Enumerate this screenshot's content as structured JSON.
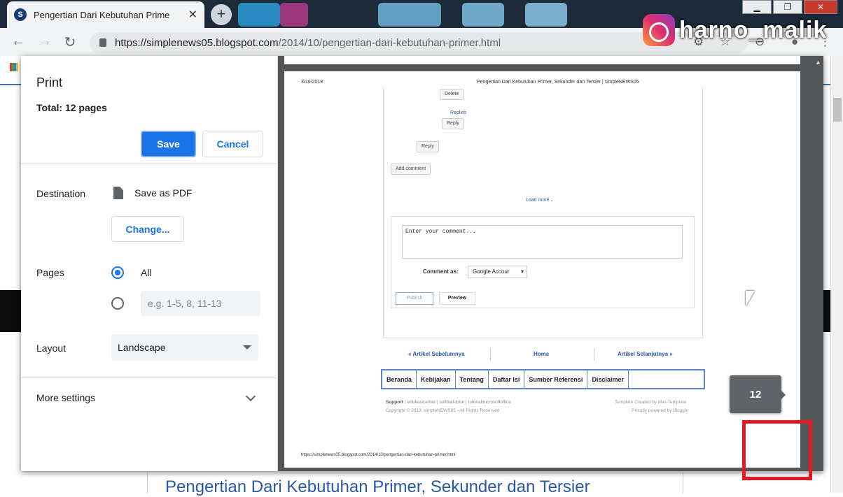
{
  "browser": {
    "tab_title": "Pengertian Dari Kebutuhan Prime",
    "tab_close": "✕",
    "new_tab": "+",
    "url_host": "https://simplenews05.blogspot.com",
    "url_path": "/2014/10/pengertian-dari-kebutuhan-primer.html",
    "window_controls": [
      "▁",
      "❐",
      "✕"
    ]
  },
  "watermark": {
    "text": "harno_malik"
  },
  "page_behind": {
    "heading": "Pengertian Dari Kebutuhan Primer, Sekunder dan Tersier"
  },
  "print": {
    "title": "Print",
    "total": "Total: 12 pages",
    "save_label": "Save",
    "cancel_label": "Cancel",
    "destination_label": "Destination",
    "destination_value": "Save as PDF",
    "change_label": "Change...",
    "pages_label": "Pages",
    "pages_all": "All",
    "pages_placeholder": "e.g. 1-5, 8, 11-13",
    "layout_label": "Layout",
    "layout_value": "Landscape",
    "more_settings": "More settings"
  },
  "preview": {
    "header_date": "3/16/2019",
    "header_title": "Pengertian Dari Kebutuhan Primer, Sekunder dan Tersier | simpleNEWS05",
    "delete": "Delete",
    "replies": "Replies",
    "reply": "Reply",
    "add_comment": "Add comment",
    "load_more": "Load more...",
    "comment_placeholder": "Enter your comment...",
    "comment_as": "Comment as:",
    "comment_as_value": "Google Accour",
    "publish": "Publish",
    "preview": "Preview",
    "prev_article": "« Artikel Sebelumnya",
    "home": "Home",
    "next_article": "Artikel Selanjutnya »",
    "menu": [
      "Beranda",
      "Kebijakan",
      "Tentang",
      "Daftar Isi",
      "Sumber Referensi",
      "Disclaimer"
    ],
    "support_label": "Support :",
    "support_links": "edukasicenter | softball-tutor | tutorialmicrosoftoffice",
    "copyright": "Copyright © 2013. simpleNEWS05 - All Rights Reserved",
    "template_credit": "Template Created by Mas Template",
    "powered_by": "Proudly powered by Blogger",
    "footer_url": "https://simplenews05.blogspot.com/2014/10/pengertian-dari-kebutuhan-primer.html",
    "page_number": "12"
  }
}
